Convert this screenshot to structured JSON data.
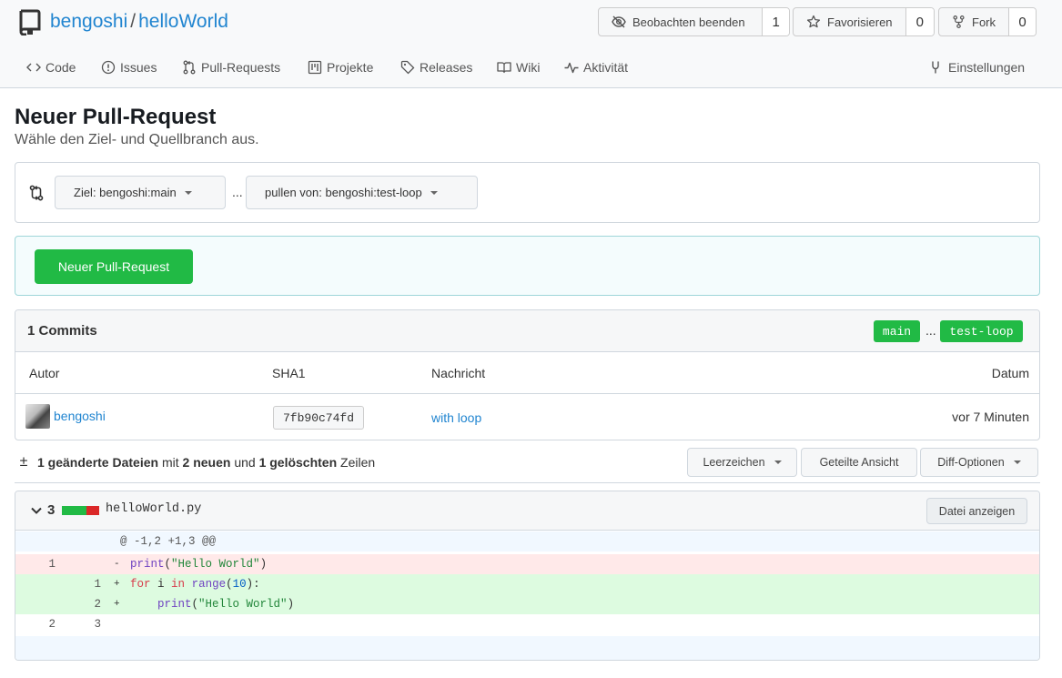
{
  "repo": {
    "owner": "bengoshi",
    "name": "helloWorld",
    "sep": "/"
  },
  "header_buttons": {
    "watch": {
      "label": "Beobachten beenden",
      "count": "1"
    },
    "star": {
      "label": "Favorisieren",
      "count": "0"
    },
    "fork": {
      "label": "Fork",
      "count": "0"
    }
  },
  "tabs": [
    {
      "label": "Code",
      "icon": "code-icon"
    },
    {
      "label": "Issues",
      "icon": "issue-icon"
    },
    {
      "label": "Pull-Requests",
      "icon": "pull-request-icon"
    },
    {
      "label": "Projekte",
      "icon": "project-icon"
    },
    {
      "label": "Releases",
      "icon": "tag-icon"
    },
    {
      "label": "Wiki",
      "icon": "book-icon"
    },
    {
      "label": "Aktivität",
      "icon": "pulse-icon"
    },
    {
      "label": "Einstellungen",
      "icon": "tools-icon"
    }
  ],
  "page": {
    "title": "Neuer Pull-Request",
    "subtitle": "Wähle den Ziel- und Quellbranch aus."
  },
  "branches": {
    "target": "Ziel: bengoshi:main",
    "source": "pullen von: bengoshi:test-loop",
    "dots": "..."
  },
  "new_pr_button": "Neuer Pull-Request",
  "commits": {
    "title": "1 Commits",
    "base_tag": "main",
    "head_tag": "test-loop",
    "tag_dots": "...",
    "columns": {
      "author": "Autor",
      "sha": "SHA1",
      "message": "Nachricht",
      "date": "Datum"
    },
    "rows": [
      {
        "author": "bengoshi",
        "sha": "7fb90c74fd",
        "message": "with loop",
        "date": "vor 7 Minuten"
      }
    ]
  },
  "diff_stats": {
    "pm": "±",
    "files": "1 geänderte Dateien",
    "mit": "mit",
    "added": "2 neuen",
    "und": "und",
    "deleted": "1 gelöschten",
    "zeilen": "Zeilen"
  },
  "diff_buttons": {
    "whitespace": "Leerzeichen",
    "split": "Geteilte Ansicht",
    "options": "Diff-Optionen"
  },
  "file": {
    "changes": "3",
    "name": "helloWorld.py",
    "view_button": "Datei anzeigen",
    "hunk": "@ -1,2 +1,3 @@",
    "lines": [
      {
        "type": "del",
        "old": "1",
        "new": "",
        "sign": "-"
      },
      {
        "type": "add",
        "old": "",
        "new": "1",
        "sign": "+"
      },
      {
        "type": "add",
        "old": "",
        "new": "2",
        "sign": "+"
      },
      {
        "type": "ctx",
        "old": "2",
        "new": "3",
        "sign": ""
      }
    ],
    "code": {
      "l1_fn": "print",
      "l1_open": "(",
      "l1_str": "\"Hello World\"",
      "l1_close": ")",
      "l2_for": "for",
      "l2_i": " i ",
      "l2_in": "in",
      "l2_range": "range",
      "l2_open": "(",
      "l2_num": "10",
      "l2_close": "):",
      "l3_indent": "    ",
      "l3_fn": "print",
      "l3_open": "(",
      "l3_str": "\"Hello World\"",
      "l3_close": ")"
    }
  },
  "colors": {
    "link": "#2185d0",
    "green": "#21ba45",
    "red": "#db2828",
    "del_bg": "#ffe0e0",
    "add_bg": "#d6fcd6",
    "hunk_bg": "#f1f8ff"
  }
}
